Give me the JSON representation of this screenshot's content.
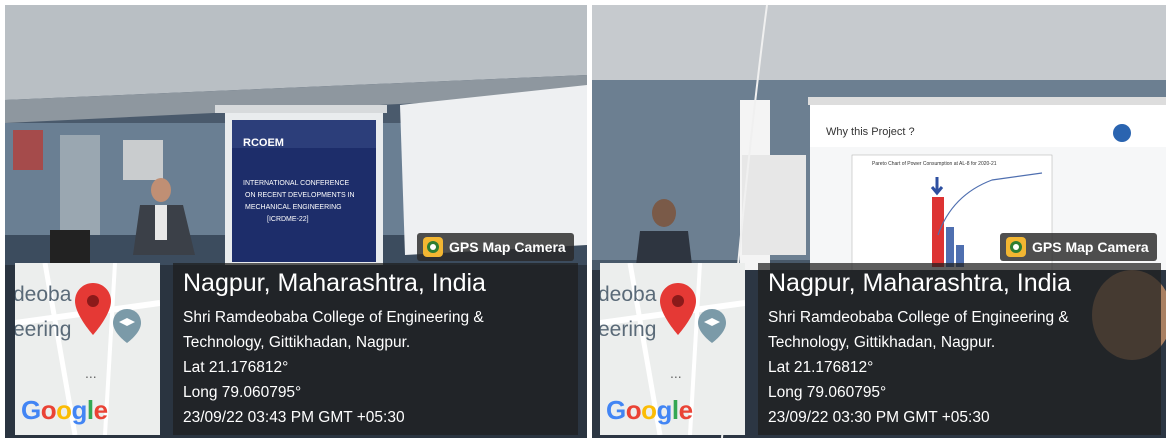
{
  "watermark": {
    "label": "GPS Map Camera"
  },
  "map": {
    "place_fragment_1": "deoba",
    "place_fragment_2": "eering",
    "google_logo": [
      "G",
      "o",
      "o",
      "g",
      "l",
      "e"
    ],
    "dots": "..."
  },
  "photos": [
    {
      "city": "Nagpur, Maharashtra, India",
      "address_line1": "Shri Ramdeobaba College of Engineering &",
      "address_line2": "Technology, Gittikhadan, Nagpur.",
      "lat": "Lat 21.176812°",
      "long": "Long 79.060795°",
      "datetime": "23/09/22 03:43 PM GMT +05:30",
      "slide_brand": "RCOEM",
      "slide_title": "INTERNATIONAL CONFERENCE ON RECENT DEVELOPMENTS IN MECHANICAL ENGINEERING [ICRDME-22]"
    },
    {
      "city": "Nagpur, Maharashtra, India",
      "address_line1": "Shri Ramdeobaba College of Engineering &",
      "address_line2": "Technology, Gittikhadan, Nagpur.",
      "lat": "Lat 21.176812°",
      "long": "Long 79.060795°",
      "datetime": "23/09/22 03:30 PM GMT +05:30",
      "slide_heading": "Why this Project ?",
      "slide_chart_title": "Pareto Chart of Power Consumption at AL-8 for 2020-21"
    }
  ]
}
